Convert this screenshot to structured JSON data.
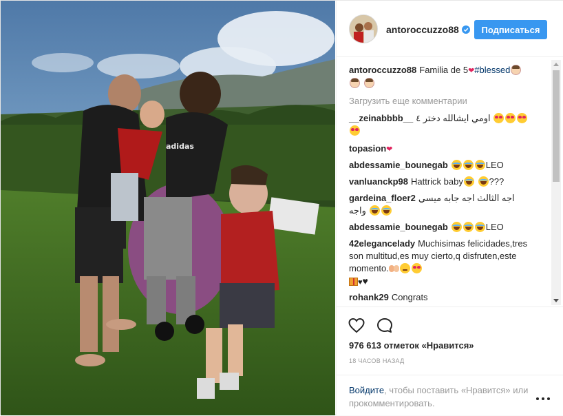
{
  "header": {
    "username": "antoroccuzzo88",
    "follow_label": "Подписаться"
  },
  "caption": {
    "username": "antoroccuzzo88",
    "text": "Familia de 5",
    "hashtag": "#blessed"
  },
  "load_more_label": "Загрузить еще комментарии",
  "comments": [
    {
      "user": "__zeinabbbb__",
      "text": "اومي ايشالله دختر ٤"
    },
    {
      "user": "topasion",
      "text": ""
    },
    {
      "user": "abdessamie_bounegab",
      "text": "LEO"
    },
    {
      "user": "vanluanckp98",
      "text": "Hattrick baby",
      "suffix": "???"
    },
    {
      "user": "gardeina_floer2",
      "text": "اجه الثالث اجه جابه ميسي",
      "text2": "واجه"
    },
    {
      "user": "abdessamie_bounegab",
      "text": "LEO"
    },
    {
      "user": "42elegancelady",
      "text": "Muchisimas felicidades,tres son multitud,es muy cierto,q disfruten,este momento."
    },
    {
      "user": "rohank29",
      "text": "Congrats"
    }
  ],
  "likes_label": "976 613 отметок «Нравится»",
  "time_label": "18 часов назад",
  "login_prompt": {
    "link": "Войдите",
    "text": ", чтобы поставить «Нравится» или прокомментировать."
  },
  "icons": {
    "like": "heart-outline-icon",
    "comment": "speech-bubble-icon",
    "more": "more-dots-icon",
    "verified": "verified-badge-icon"
  },
  "colors": {
    "accent": "#3897f0",
    "link": "#003569",
    "muted": "#999999",
    "text": "#262626"
  }
}
